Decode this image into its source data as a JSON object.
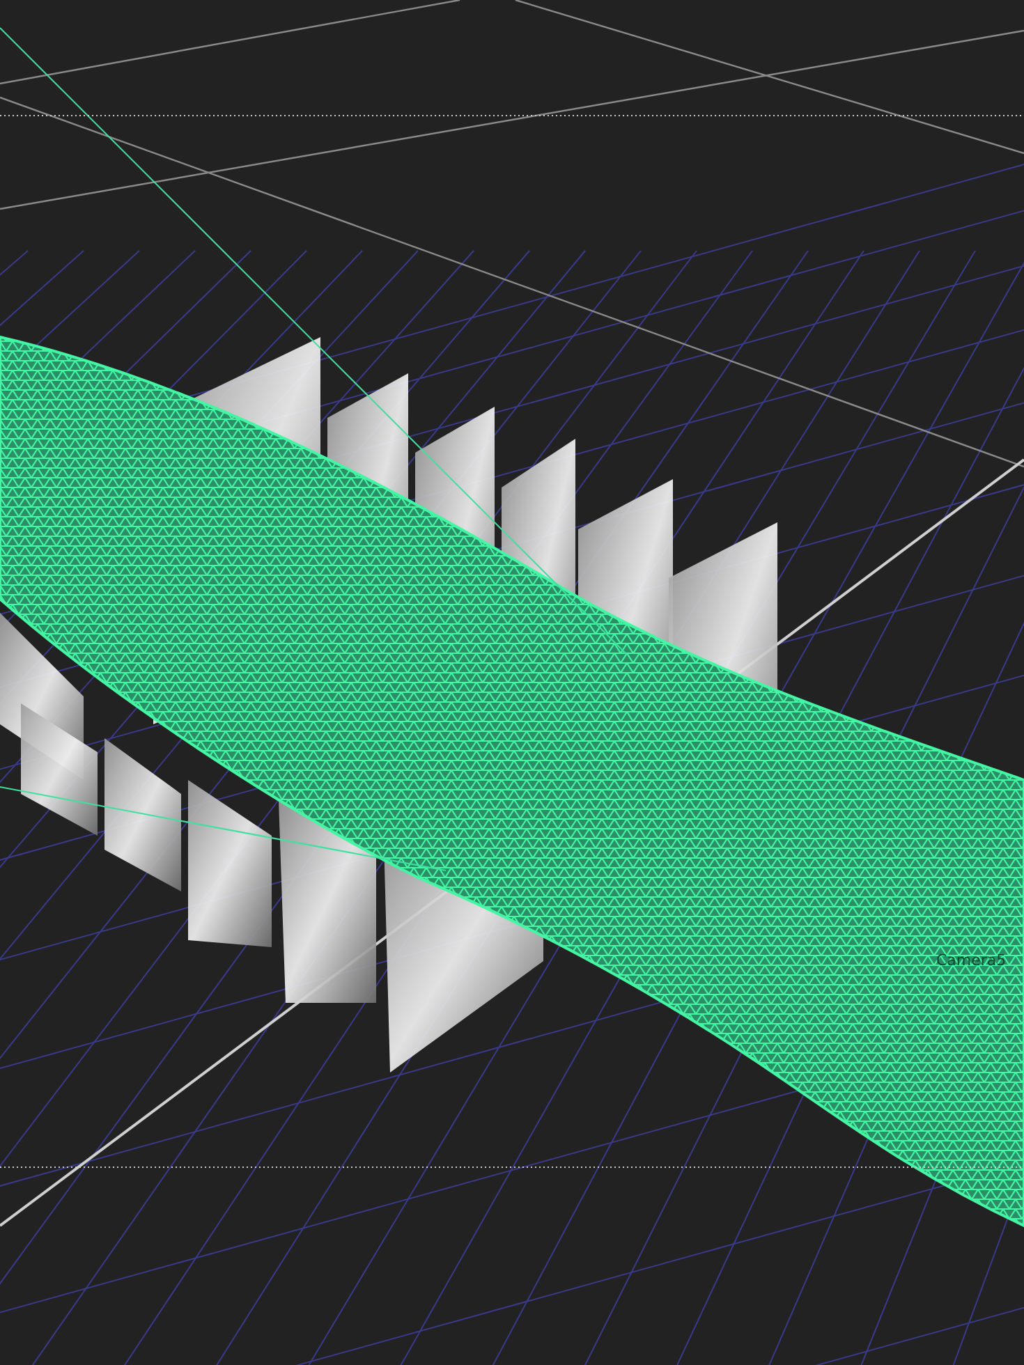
{
  "viewport": {
    "camera_label": "Camera5"
  }
}
